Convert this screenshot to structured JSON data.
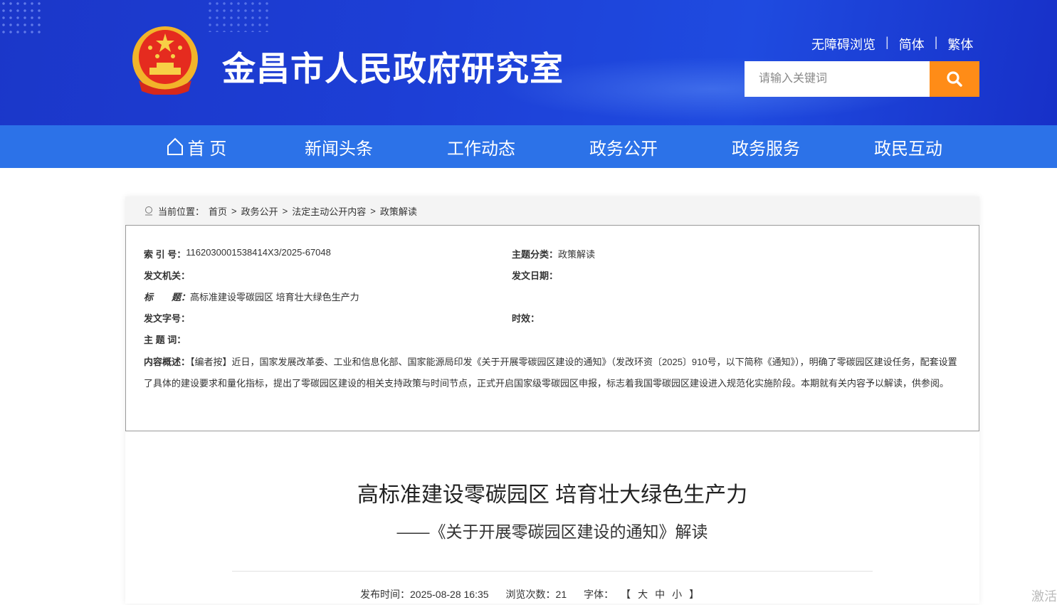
{
  "header": {
    "site_title": "金昌市人民政府研究室",
    "links": [
      "无障碍浏览",
      "简体",
      "繁体"
    ],
    "separator": "|",
    "search_placeholder": "请输入关键词"
  },
  "nav": [
    "首 页",
    "新闻头条",
    "工作动态",
    "政务公开",
    "政务服务",
    "政民互动"
  ],
  "breadcrumb": {
    "label": "当前位置：",
    "items": [
      "首页",
      "政务公开",
      "法定主动公开内容",
      "政策解读"
    ],
    "sep": ">"
  },
  "info": {
    "index_label": "索 引 号：",
    "index_value": "1162030001538414X3/2025-67048",
    "category_label": "主题分类：",
    "category_value": "政策解读",
    "issuer_label": "发文机关：",
    "date_label": "发文日期：",
    "title_label": "标　　题：",
    "title_value": "高标准建设零碳园区 培育壮大绿色生产力",
    "docno_label": "发文字号：",
    "validity_label": "时效：",
    "keywords_label": "主 题 词：",
    "summary_label": "内容概述：",
    "summary_value": "【编者按】近日，国家发展改革委、工业和信息化部、国家能源局印发《关于开展零碳园区建设的通知》（发改环资〔2025〕910号，以下简称《通知》），明确了零碳园区建设任务，配套设置了具体的建设要求和量化指标，提出了零碳园区建设的相关支持政策与时间节点，正式开启国家级零碳园区申报，标志着我国零碳园区建设进入规范化实施阶段。本期就有关内容予以解读，供参阅。"
  },
  "article": {
    "title": "高标准建设零碳园区 培育壮大绿色生产力",
    "subtitle": "——《关于开展零碳园区建设的通知》解读",
    "publish_label": "发布时间：",
    "publish_value": "2025-08-28 16:35",
    "views_label": "浏览次数：",
    "views_value": "21",
    "font_label": "字体：",
    "font_open": "【",
    "font_sizes": [
      "大",
      "中",
      "小"
    ],
    "font_close": "】"
  },
  "watermark": "激活"
}
